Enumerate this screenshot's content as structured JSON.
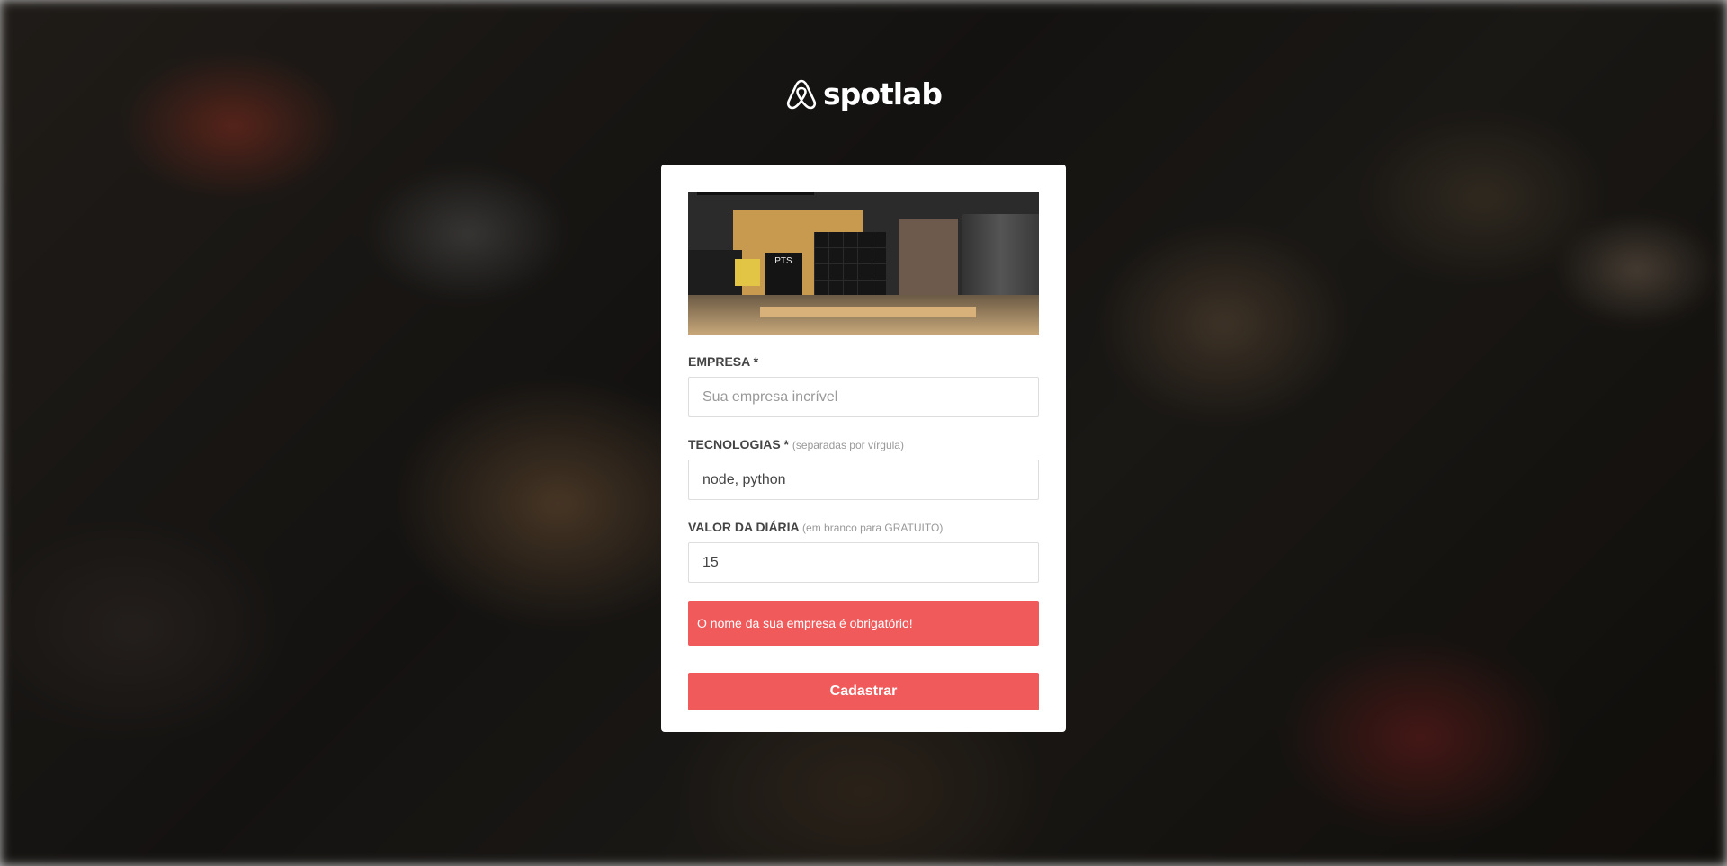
{
  "brand": {
    "name": "spotlab",
    "icon": "airbnb-logo-icon"
  },
  "hero": {
    "panel_text": "PTS",
    "panel_text_2": "PTS"
  },
  "form": {
    "company": {
      "label": "EMPRESA *",
      "placeholder": "Sua empresa incrível",
      "value": ""
    },
    "technologies": {
      "label": "TECNOLOGIAS *",
      "hint": "(separadas por vírgula)",
      "value": "node, python"
    },
    "price": {
      "label": "VALOR DA DIÁRIA",
      "hint": "(em branco para GRATUITO)",
      "value": "15"
    },
    "error_message": "O nome da sua empresa é obrigatório!",
    "submit_label": "Cadastrar"
  },
  "colors": {
    "accent": "#f05a5b",
    "label": "#444444",
    "hint": "#999999"
  }
}
